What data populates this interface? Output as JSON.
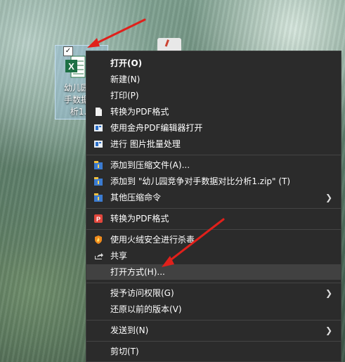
{
  "desktop": {
    "file_label": "幼儿园竞\n手数据对\n析1.x",
    "checkbox": "✓",
    "excel_letter": "X"
  },
  "menu": {
    "items": [
      {
        "label": "打开(O)",
        "bold": true,
        "icon": ""
      },
      {
        "label": "新建(N)",
        "icon": ""
      },
      {
        "label": "打印(P)",
        "icon": ""
      },
      {
        "label": "转换为PDF格式",
        "icon": "pdf-page-icon"
      },
      {
        "label": "使用金舟PDF编辑器打开",
        "icon": "pdf-editor-icon"
      },
      {
        "label": "进行 图片批量处理",
        "icon": "image-batch-icon"
      },
      {
        "label": "添加到压缩文件(A)...",
        "icon": "archive-icon"
      },
      {
        "label": "添加到 \"幼儿园竞争对手数据对比分析1.zip\" (T)",
        "icon": "archive-icon"
      },
      {
        "label": "其他压缩命令",
        "icon": "archive-icon",
        "submenu": true
      },
      {
        "label": "转换为PDF格式",
        "icon": "pdf-convert-icon"
      },
      {
        "label": "使用火绒安全进行杀毒",
        "icon": "huorong-shield-icon"
      },
      {
        "label": "共享",
        "icon": "share-icon"
      },
      {
        "label": "打开方式(H)...",
        "icon": "",
        "hover": true
      },
      {
        "label": "授予访问权限(G)",
        "icon": "",
        "submenu": true
      },
      {
        "label": "还原以前的版本(V)",
        "icon": ""
      },
      {
        "label": "发送到(N)",
        "icon": "",
        "submenu": true
      },
      {
        "label": "剪切(T)",
        "icon": ""
      }
    ],
    "chevron": "❯"
  },
  "colors": {
    "menu_bg": "#2b2b2b",
    "hover_bg": "#414141",
    "arrow": "#e0201b",
    "excel_green": "#1d7044"
  }
}
